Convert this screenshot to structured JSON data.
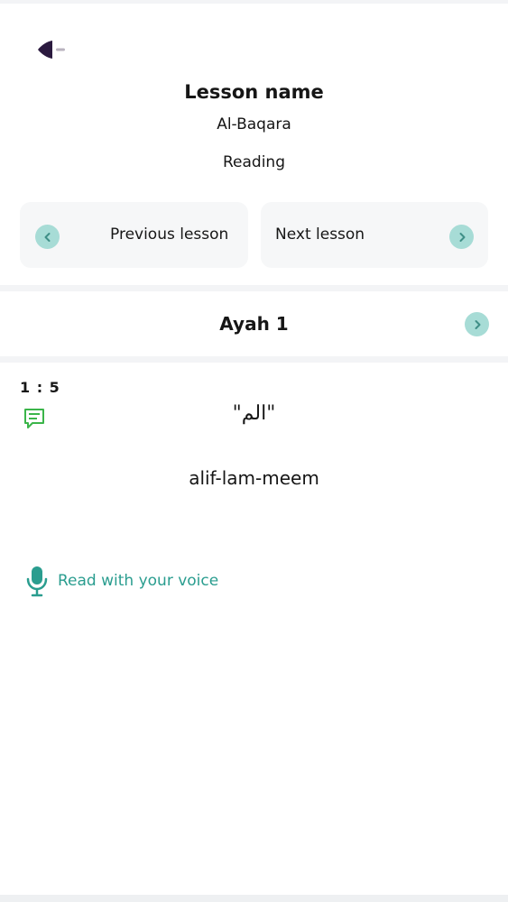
{
  "header": {
    "heading": "Lesson name",
    "surah": "Al-Baqara",
    "mode": "Reading"
  },
  "navigation": {
    "previous_label": "Previous lesson",
    "next_label": "Next lesson"
  },
  "ayah": {
    "title": "Ayah 1",
    "reference": "1 : 5",
    "arabic": "\"الم\"",
    "transliteration": "alif-lam-meem"
  },
  "voice": {
    "label": "Read with your voice"
  },
  "colors": {
    "accent": "#2a9d8f",
    "accent_light": "#a7dcd6",
    "comment_icon": "#3bb54a",
    "back_icon": "#2b1a3f"
  }
}
